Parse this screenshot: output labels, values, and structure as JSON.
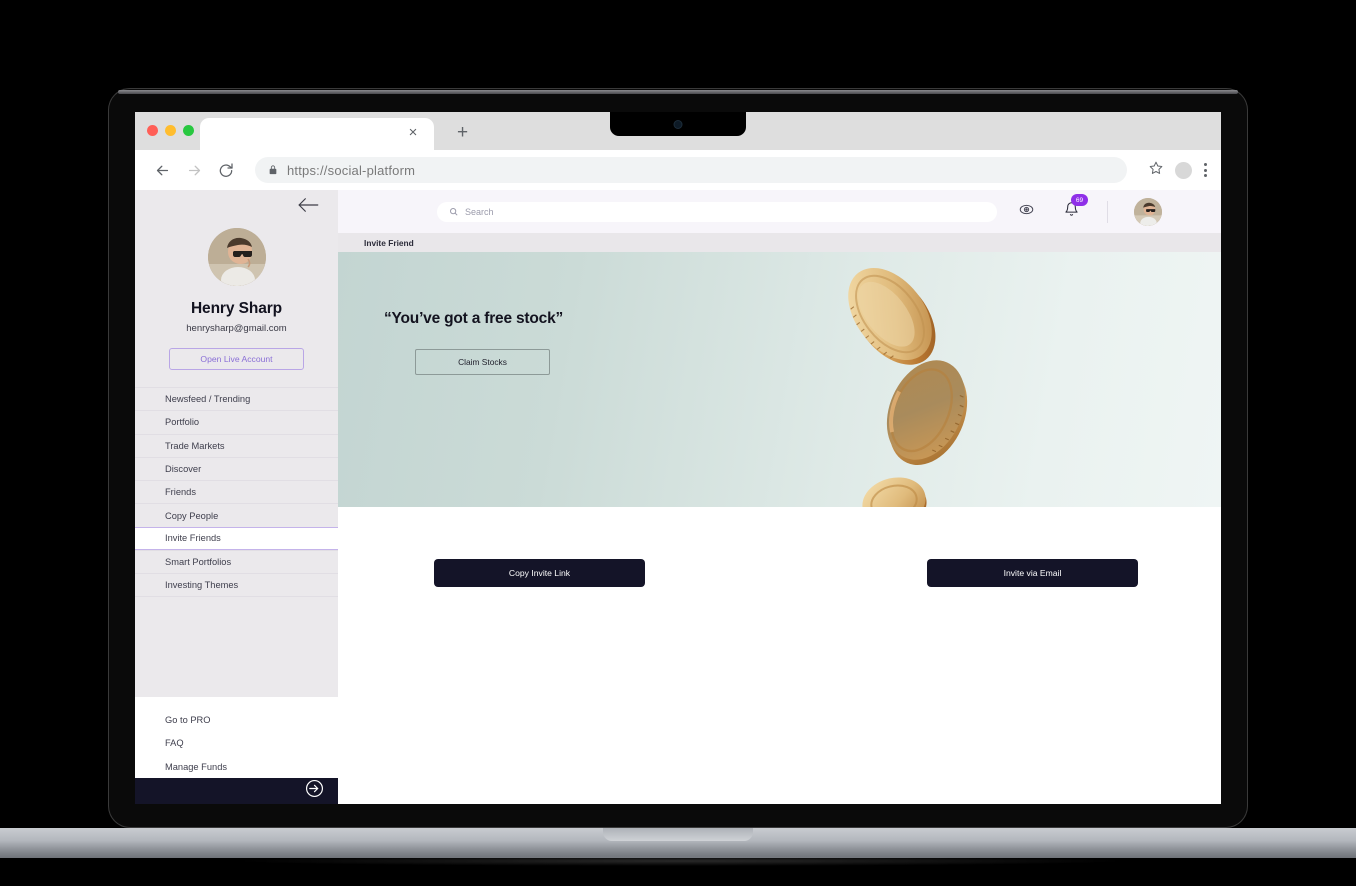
{
  "browser": {
    "tab_close_label": "×",
    "new_tab_label": "+",
    "url": "https://social-platform"
  },
  "sidebar": {
    "user": {
      "name": "Henry Sharp",
      "email": "henrysharp@gmail.com"
    },
    "live_account_button": "Open Live Account",
    "items": [
      {
        "label": "Newsfeed / Trending",
        "active": false
      },
      {
        "label": "Portfolio",
        "active": false
      },
      {
        "label": "Trade Markets",
        "active": false
      },
      {
        "label": "Discover",
        "active": false
      },
      {
        "label": "Friends",
        "active": false
      },
      {
        "label": "Copy People",
        "active": false
      },
      {
        "label": "Invite Friends",
        "active": true
      },
      {
        "label": "Smart Portfolios",
        "active": false
      },
      {
        "label": "Investing Themes",
        "active": false
      }
    ],
    "bottom_items": [
      {
        "label": "Go to PRO"
      },
      {
        "label": "FAQ"
      },
      {
        "label": "Manage Funds"
      }
    ]
  },
  "topbar": {
    "search_placeholder": "Search",
    "notification_count": "69",
    "accent_color": "#8f2fe8"
  },
  "breadcrumb": {
    "label": "Invite Friend"
  },
  "banner": {
    "headline": "“You’ve got a free stock”",
    "claim_button": "Claim Stocks",
    "gradient_from": "#c3d5d2",
    "gradient_to": "#eff5f4"
  },
  "cta": {
    "copy_link_button": "Copy Invite Link",
    "email_button": "Invite via Email",
    "button_color": "#141428"
  }
}
